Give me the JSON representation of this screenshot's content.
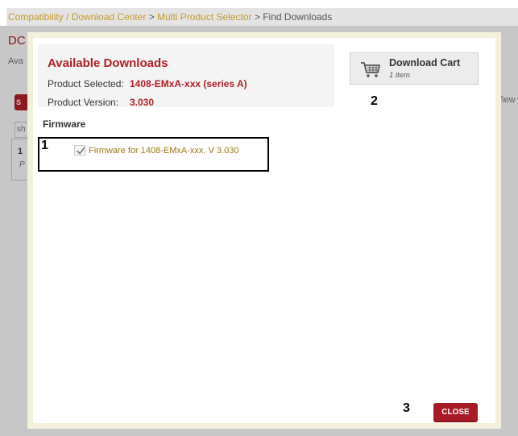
{
  "breadcrumb": {
    "items": [
      "Compatibility / Download Center",
      "Multi Product Selector",
      "Find Downloads"
    ],
    "separator": ">"
  },
  "background": {
    "title_partial": "DC",
    "subtitle_partial": "Ava",
    "button_partial": "S",
    "input_partial": "sh",
    "row_number": "1",
    "row_letter": "P",
    "view_partial": "/iew"
  },
  "modal": {
    "title": "Available Downloads",
    "product_selected_label": "Product Selected:",
    "product_selected_value": "1408-EMxA-xxx (series A)",
    "product_version_label": "Product Version:",
    "product_version_value": "3.030",
    "cart": {
      "label": "Download Cart",
      "count": "1 item",
      "icon": "shopping-cart-icon"
    },
    "firmware_heading": "Firmware",
    "firmware_items": [
      {
        "label": "Firmware for 1408-EMxA-xxx, V 3.030",
        "checked": true
      }
    ],
    "close_label": "CLOSE"
  },
  "annotations": {
    "callout_1": "1",
    "callout_2": "2",
    "callout_3": "3"
  },
  "colors": {
    "accent": "#b22027",
    "link": "#c69a2a",
    "firmware_text": "#9a7a14",
    "modal_frame": "#f3f0dc"
  }
}
